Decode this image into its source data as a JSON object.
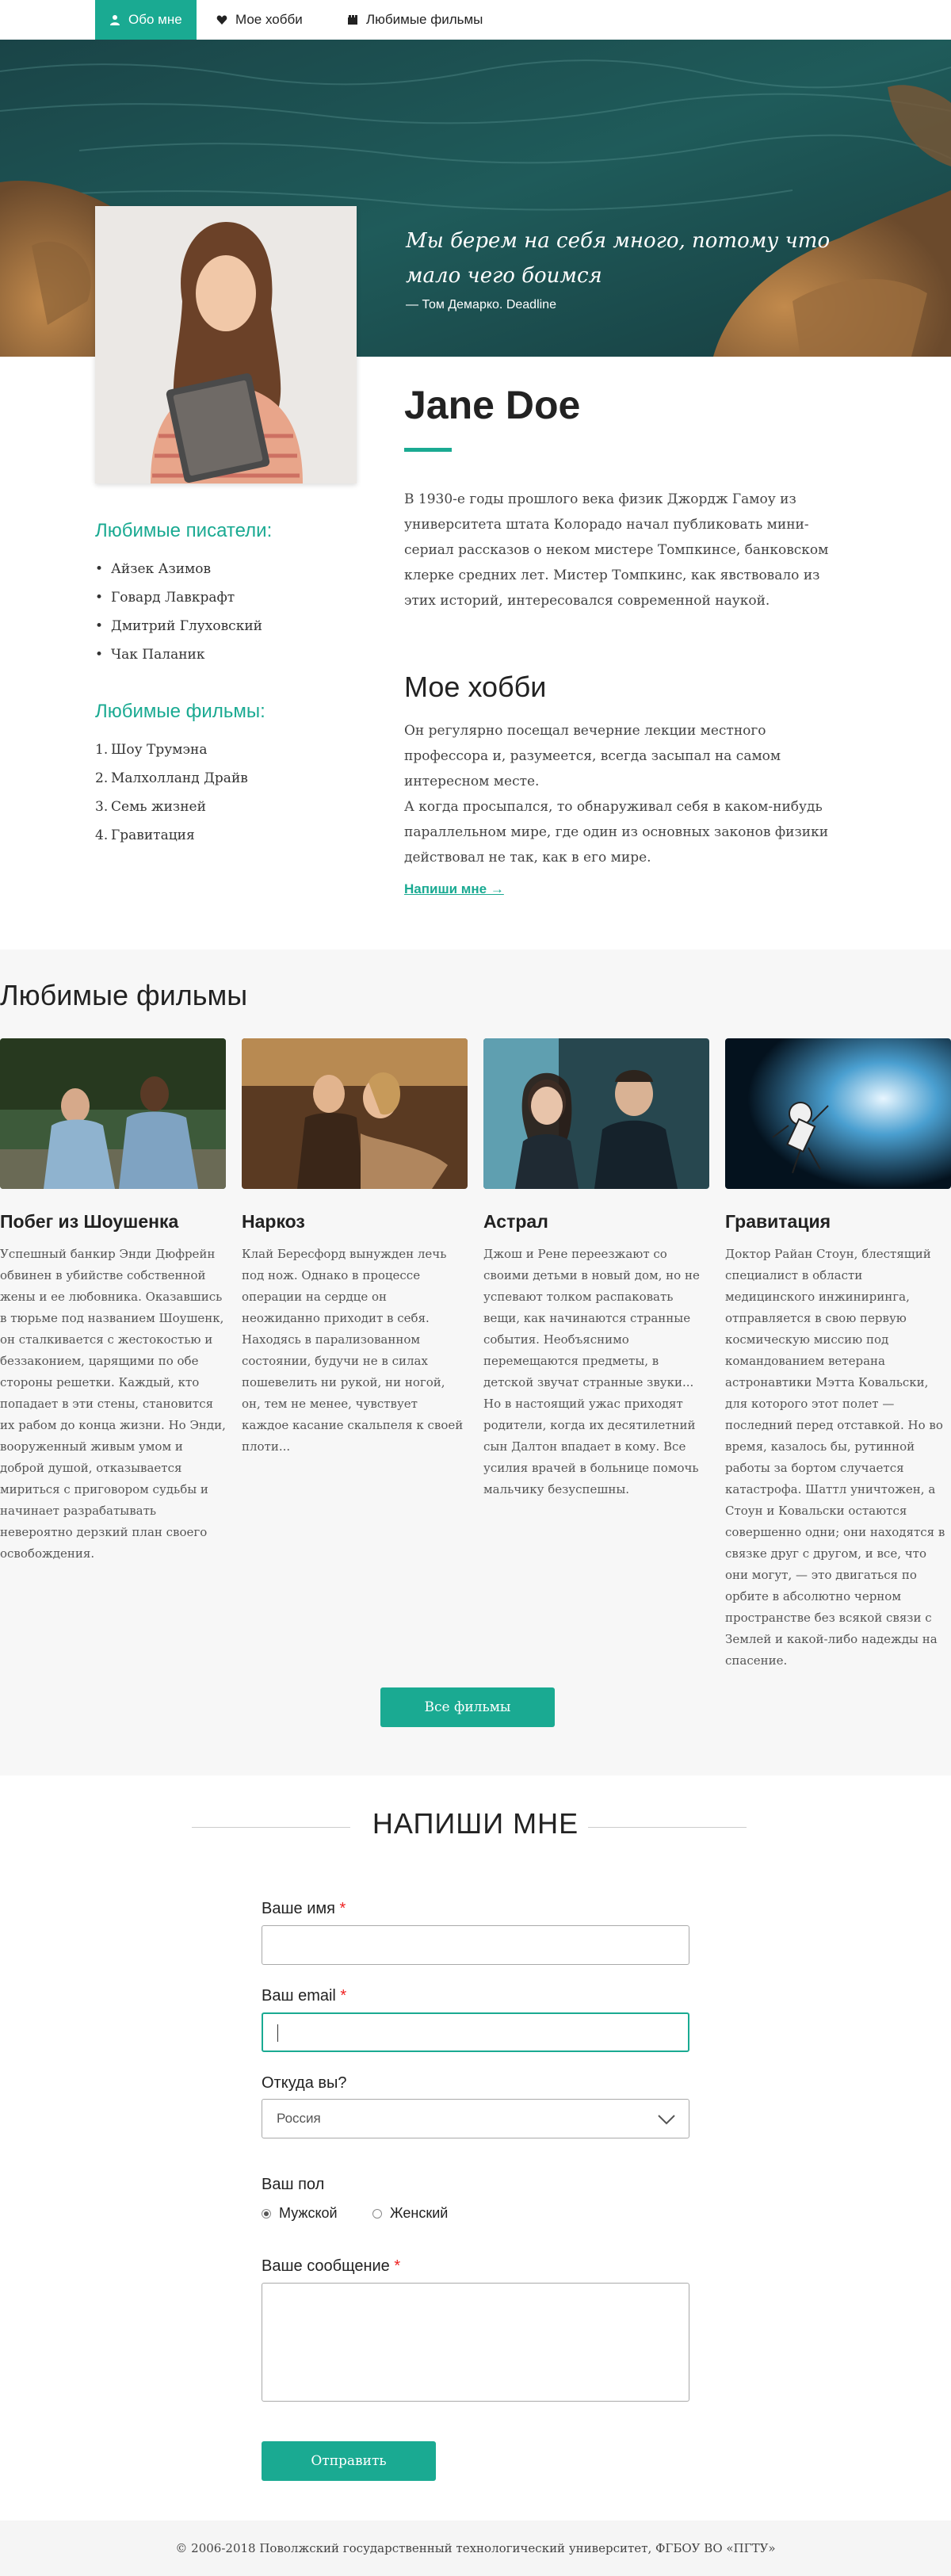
{
  "nav": {
    "items": [
      {
        "label": "Обо мне",
        "icon": "user-icon",
        "active": true
      },
      {
        "label": "Мое хобби",
        "icon": "heart-icon",
        "active": false
      },
      {
        "label": "Любимые фильмы",
        "icon": "film-icon",
        "active": false
      }
    ]
  },
  "hero": {
    "quote": "Мы берем на себя много, потому что мало чего боимся",
    "author": "— Том Демарко. Deadline"
  },
  "profile": {
    "name": "Jane Doe",
    "bio": "В 1930-е годы прошлого века физик Джордж Гамоу из университета штата Колорадо начал публиковать мини-сериал рассказов о неком мистере Томпкинсе, банковском клерке средних лет. Мистер Томпкинс, как явствовало из этих историй, интересовался современной наукой."
  },
  "sidebar": {
    "writers_title": "Любимые писатели:",
    "writers": [
      "Айзек Азимов",
      "Говард Лавкрафт",
      "Дмитрий Глуховский",
      "Чак Паланик"
    ],
    "films_title": "Любимые фильмы:",
    "films": [
      "Шоу Трумэна",
      "Малхолланд Драйв",
      "Семь жизней",
      "Гравитация"
    ]
  },
  "hobby": {
    "title": "Мое хобби",
    "text1": "Он регулярно посещал вечерние лекции местного профессора и, разумеется, всегда засыпал на самом интересном месте.",
    "text2": "А когда просыпался, то обнаруживал себя в каком-нибудь параллельном мире, где один из основных законов физики действовал не так, как в его мире.",
    "link": "Напиши мне →"
  },
  "films_section": {
    "title": "Любимые фильмы",
    "films": [
      {
        "title": "Побег из Шоушенка",
        "desc": "Успешный банкир Энди Дюфрейн обвинен в убийстве собственной жены и ее любовника. Оказавшись в тюрьме под названием Шоушенк, он сталкивается с жестокостью и беззаконием, царящими по обе стороны решетки. Каждый, кто попадает в эти стены, становится их рабом до конца жизни. Но Энди, вооруженный живым умом и доброй душой, отказывается мириться с приговором судьбы и начинает разрабатывать невероятно дерзкий план своего освобождения."
      },
      {
        "title": "Наркоз",
        "desc": "Клай Бересфорд вынужден лечь под нож. Однако в процессе операции на сердце он неожиданно приходит в себя. Находясь в парализованном состоянии, будучи не в силах пошевелить ни рукой, ни ногой, он, тем не менее, чувствует каждое касание скальпеля к своей плоти..."
      },
      {
        "title": "Астрал",
        "desc": "Джош и Рене переезжают со своими детьми в новый дом, но не успевают толком распаковать вещи, как начинаются странные события. Необъяснимо перемещаются предметы, в детской звучат странные звуки... Но в настоящий ужас приходят родители, когда их десятилетний сын Далтон впадает в кому. Все усилия врачей в больнице помочь мальчику безуспешны."
      },
      {
        "title": "Гравитация",
        "desc": "Доктор Райан Стоун, блестящий специалист в области медицинского инжиниринга, отправляется в свою первую космическую миссию под командованием ветерана астронавтики Мэтта Ковальски, для которого этот полет — последний перед отставкой. Но во время, казалось бы, рутинной работы за бортом случается катастрофа. Шаттл уничтожен, а Стоун и Ковальски остаются совершенно одни; они находятся в связке друг с другом, и все, что они могут, — это двигаться по орбите в абсолютно черном пространстве без всякой связи с Землей и какой-либо надежды на спасение."
      }
    ],
    "button": "Все фильмы"
  },
  "contact": {
    "title": "НАПИШИ МНЕ",
    "name_label": "Ваше имя",
    "email_label": "Ваш email",
    "country_label": "Откуда вы?",
    "country_value": "Россия",
    "gender_label": "Ваш пол",
    "gender_male": "Мужской",
    "gender_female": "Женский",
    "message_label": "Ваше сообщение",
    "required_mark": "*",
    "submit": "Отправить"
  },
  "footer": {
    "text": "© 2006-2018 Поволжский государственный технологический университет, ФГБОУ ВО «ПГТУ»"
  },
  "colors": {
    "accent": "#1aaa92",
    "required": "#ee2222",
    "section_bg": "#f7f7f7"
  }
}
